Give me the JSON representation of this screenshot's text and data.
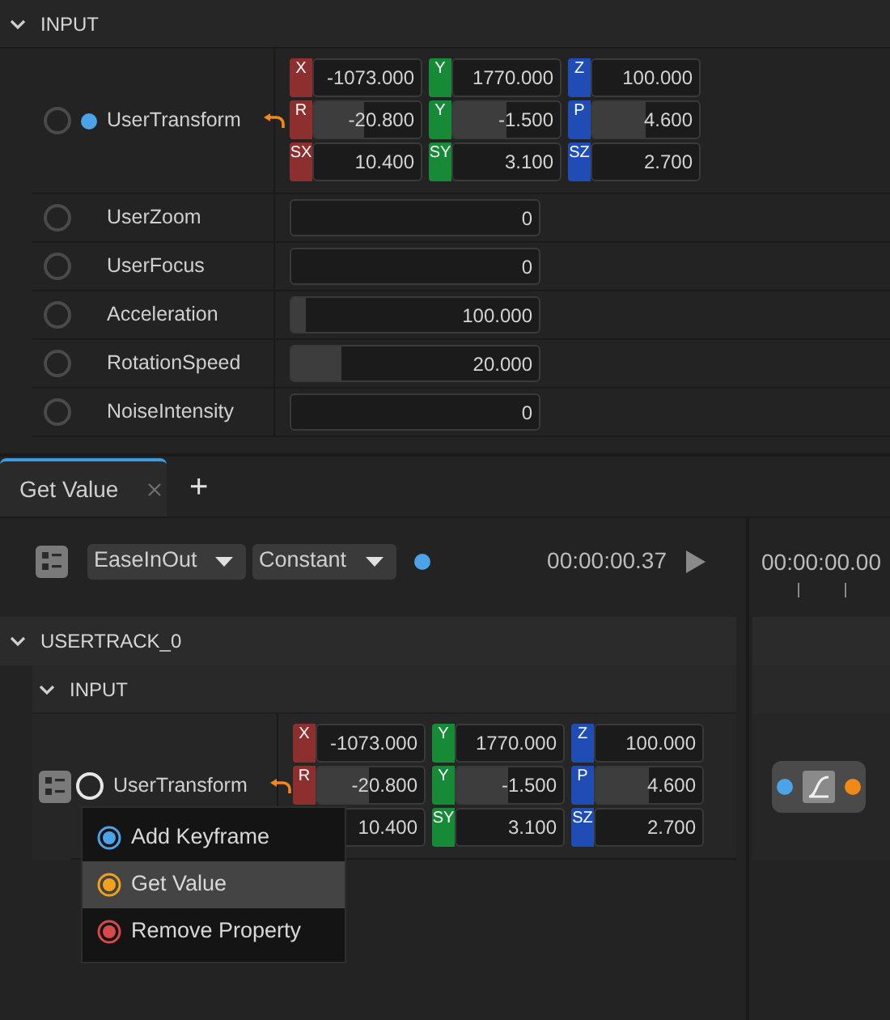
{
  "inspector": {
    "section": {
      "label": "INPUT",
      "expanded": true
    },
    "properties": [
      {
        "kind": "transform",
        "name": "UserTransform",
        "active": false,
        "animated": true,
        "modified": true,
        "rows": [
          [
            {
              "label": "X",
              "color": "#8e2f2f",
              "value": "-1073.000"
            },
            {
              "label": "Y",
              "color": "#178a37",
              "value": "1770.000"
            },
            {
              "label": "Z",
              "color": "#1f4db5",
              "value": "100.000"
            }
          ],
          [
            {
              "label": "R",
              "color": "#8e2f2f",
              "value": "-20.800",
              "level": 0.47
            },
            {
              "label": "Y",
              "color": "#178a37",
              "value": "-1.500",
              "level": 0.5
            },
            {
              "label": "P",
              "color": "#1f4db5",
              "value": "4.600",
              "level": 0.5
            }
          ],
          [
            {
              "label": "SX",
              "color": "#8e2f2f",
              "value": "10.400"
            },
            {
              "label": "SY",
              "color": "#178a37",
              "value": "3.100"
            },
            {
              "label": "SZ",
              "color": "#1f4db5",
              "value": "2.700"
            }
          ]
        ]
      },
      {
        "kind": "number",
        "name": "UserZoom",
        "active": false,
        "animated": false,
        "modified": false,
        "value": "0"
      },
      {
        "kind": "number",
        "name": "UserFocus",
        "active": false,
        "animated": false,
        "modified": false,
        "value": "0"
      },
      {
        "kind": "number",
        "name": "Acceleration",
        "active": false,
        "animated": false,
        "modified": false,
        "value": "100.000",
        "level": 0.06
      },
      {
        "kind": "number",
        "name": "RotationSpeed",
        "active": false,
        "animated": false,
        "modified": false,
        "value": "20.000",
        "level": 0.2
      },
      {
        "kind": "number",
        "name": "NoiseIntensity",
        "active": false,
        "animated": false,
        "modified": false,
        "value": "0"
      }
    ]
  },
  "tabs": [
    {
      "label": "Get Value",
      "selected": true
    }
  ],
  "add_tab": "+",
  "toolbar": {
    "dropdowns": [
      "EaseInOut",
      "Constant"
    ],
    "time": "00:00:00.37"
  },
  "ruler": {
    "time": "00:00:00.00"
  },
  "tracks": [
    {
      "label": "USERTRACK_0",
      "expanded": true,
      "children": [
        {
          "label": "INPUT",
          "expanded": true,
          "properties": [
            {
              "kind": "transform",
              "name": "UserTransform",
              "active": true,
              "animated": false,
              "modified": true,
              "rows": [
                [
                  {
                    "label": "X",
                    "color": "#8e2f2f",
                    "value": "-1073.000"
                  },
                  {
                    "label": "Y",
                    "color": "#178a37",
                    "value": "1770.000"
                  },
                  {
                    "label": "Z",
                    "color": "#1f4db5",
                    "value": "100.000"
                  }
                ],
                [
                  {
                    "label": "R",
                    "color": "#8e2f2f",
                    "value": "-20.800",
                    "level": 0.48
                  },
                  {
                    "label": "Y",
                    "color": "#178a37",
                    "value": "-1.500",
                    "level": 0.48
                  },
                  {
                    "label": "P",
                    "color": "#1f4db5",
                    "value": "4.600",
                    "level": 0.5
                  }
                ],
                [
                  {
                    "value": "10.400"
                  },
                  {
                    "label": "SY",
                    "color": "#178a37",
                    "value": "3.100"
                  },
                  {
                    "label": "SZ",
                    "color": "#1f4db5",
                    "value": "2.700"
                  }
                ]
              ]
            }
          ]
        }
      ]
    }
  ],
  "context_menu": [
    {
      "label": "Add Keyframe",
      "color": "#4da3e8",
      "selected": false
    },
    {
      "label": "Get Value",
      "color": "#f2a11a",
      "selected": true
    },
    {
      "label": "Remove Property",
      "color": "#d9484a",
      "selected": false
    }
  ]
}
